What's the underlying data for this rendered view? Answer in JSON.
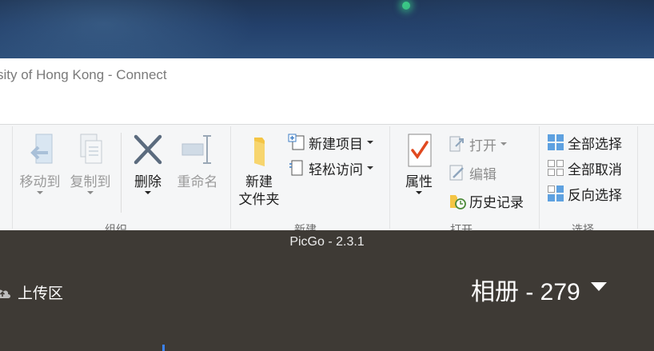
{
  "explorer": {
    "window_title": "sity of Hong Kong - Connect",
    "ribbon": {
      "groups": [
        {
          "label": "组织",
          "buttons": [
            "移动到",
            "复制到",
            "删除",
            "重命名"
          ]
        },
        {
          "label": "新建",
          "buttons": [
            "新建",
            "文件夹",
            "新建项目",
            "轻松访问"
          ]
        },
        {
          "label": "打开",
          "buttons": [
            "属性",
            "打开",
            "编辑",
            "历史记录"
          ]
        },
        {
          "label": "选择",
          "buttons": [
            "全部选择",
            "全部取消",
            "反向选择"
          ]
        }
      ]
    }
  },
  "picgo": {
    "title": "PicGo - 2.3.1",
    "sidebar_item": "上传区",
    "album_title": "相册 - 279"
  }
}
